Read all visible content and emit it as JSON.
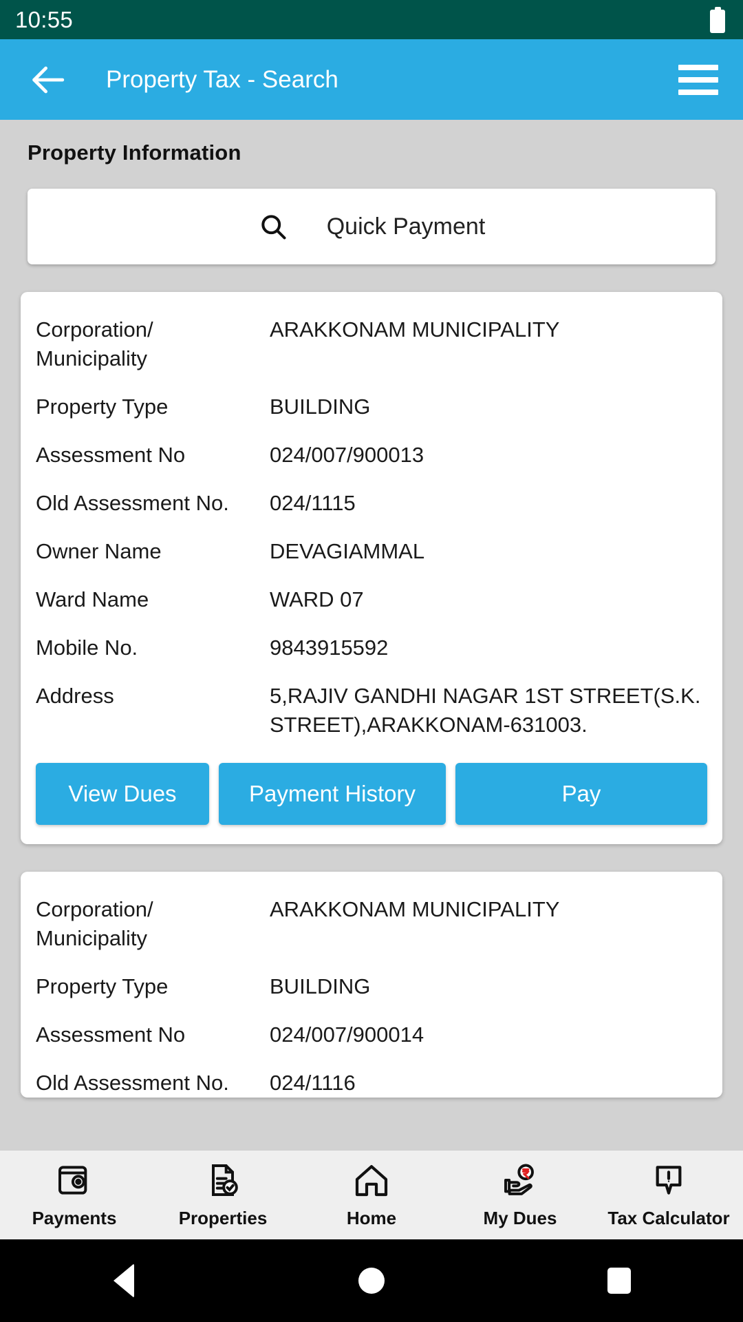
{
  "status_bar": {
    "time": "10:55",
    "battery_icon": "battery-full-icon"
  },
  "app_bar": {
    "back_icon": "back-arrow-icon",
    "title": "Property Tax - Search",
    "menu_icon": "hamburger-menu-icon"
  },
  "colors": {
    "status_bar_bg": "#00544a",
    "app_bar_bg": "#2bace2",
    "page_bg": "#d2d2d2",
    "card_bg": "#ffffff",
    "button_bg": "#2bace2",
    "button_text": "#ffffff",
    "nav_bg": "#efefef",
    "rupee_accent": "#e02020"
  },
  "main": {
    "section_title": "Property Information",
    "quick_payment": {
      "icon": "search-icon",
      "label": "Quick Payment"
    },
    "field_labels": {
      "corporation": "Corporation/\nMunicipality",
      "property_type": "Property Type",
      "assessment_no": "Assessment No",
      "old_assessment_no": "Old Assessment No.",
      "owner_name": "Owner Name",
      "ward_name": "Ward Name",
      "mobile_no": "Mobile No.",
      "address": "Address"
    },
    "cards": [
      {
        "corporation": "ARAKKONAM MUNICIPALITY",
        "property_type": "BUILDING",
        "assessment_no": "024/007/900013",
        "old_assessment_no": "024/1115",
        "owner_name": "DEVAGIAMMAL",
        "ward_name": "WARD 07",
        "mobile_no": "9843915592",
        "address": "5,RAJIV GANDHI NAGAR 1ST STREET(S.K. STREET),ARAKKONAM-631003.",
        "buttons": {
          "view_dues": "View Dues",
          "payment_history": "Payment History",
          "pay": "Pay"
        }
      },
      {
        "corporation": "ARAKKONAM MUNICIPALITY",
        "property_type": "BUILDING",
        "assessment_no": "024/007/900014",
        "old_assessment_no": "024/1116"
      }
    ]
  },
  "bottom_nav": {
    "items": [
      {
        "label": "Payments",
        "icon": "wallet-icon"
      },
      {
        "label": "Properties",
        "icon": "document-check-icon"
      },
      {
        "label": "Home",
        "icon": "home-icon"
      },
      {
        "label": "My Dues",
        "icon": "hand-rupee-icon"
      },
      {
        "label": "Tax Calculator",
        "icon": "speech-bubble-exclaim-icon"
      }
    ]
  },
  "system_nav": {
    "back": "back-triangle-icon",
    "home": "home-circle-icon",
    "recents": "recents-square-icon"
  }
}
